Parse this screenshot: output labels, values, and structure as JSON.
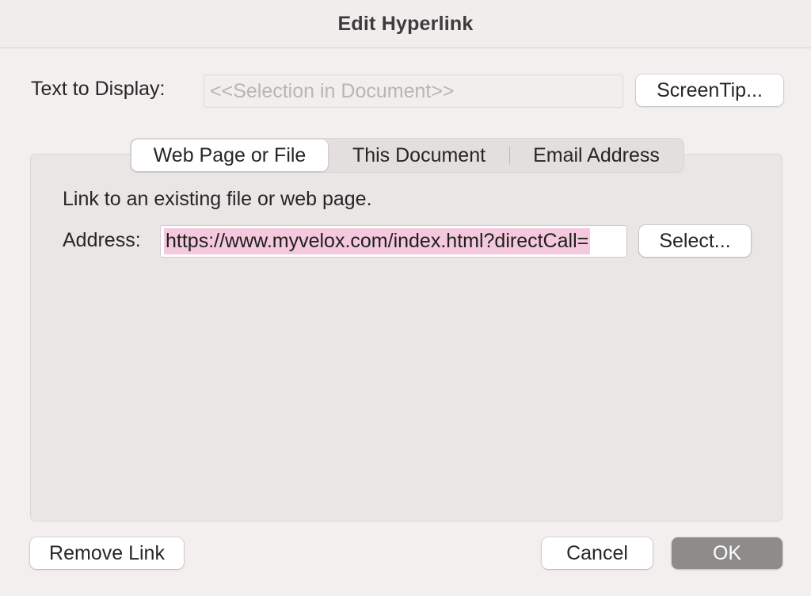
{
  "dialog": {
    "title": "Edit Hyperlink"
  },
  "text_to_display": {
    "label": "Text to Display:",
    "placeholder": "<<Selection in Document>>",
    "value": ""
  },
  "screentip_label": "ScreenTip...",
  "tabs": [
    {
      "label": "Web Page or File",
      "active": true
    },
    {
      "label": "This Document",
      "active": false
    },
    {
      "label": "Email Address",
      "active": false
    }
  ],
  "panel": {
    "description": "Link to an existing file or web page.",
    "address_label": "Address:",
    "address_value": "https://www.myvelox.com/index.html?directCall=",
    "select_label": "Select..."
  },
  "footer": {
    "remove_link_label": "Remove Link",
    "cancel_label": "Cancel",
    "ok_label": "OK"
  },
  "colors": {
    "selection_highlight": "#f4c9de",
    "ok_button": "#8e8b8b"
  }
}
